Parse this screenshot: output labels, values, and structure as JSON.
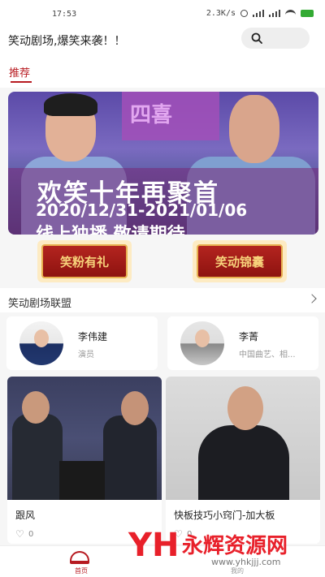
{
  "status": {
    "time": "17:53",
    "net_speed": "2.3K/s"
  },
  "topbar": {
    "slogan": "笑动剧场,爆笑来袭！！",
    "search_icon": "search-icon"
  },
  "tabs": [
    {
      "label": "推荐",
      "active": true
    }
  ],
  "banner": {
    "bg_text": "四喜",
    "title": "欢笑十年再聚首",
    "date_range": "2020/12/31-2021/01/06",
    "subtitle": "线上独播  敬请期待"
  },
  "buttons": {
    "fans_gift": "笑粉有礼",
    "smile_bag": "笑动锦囊"
  },
  "alliance": {
    "title": "笑动剧场联盟",
    "artists": [
      {
        "name": "李伟建",
        "role": "演员"
      },
      {
        "name": "李菁",
        "role": "中国曲艺、相..."
      }
    ]
  },
  "videos": [
    {
      "title": "跟风",
      "likes": "0"
    },
    {
      "title": "快板技巧小窍门-加大板",
      "likes": "0"
    }
  ],
  "bottom_nav": {
    "home": "首页",
    "mine": "我的"
  },
  "watermark": {
    "logo": "YH",
    "name": "永辉资源网",
    "url": "www.yhkjjj.com"
  },
  "colors": {
    "accent": "#b71a20",
    "button_gold": "#f7d27b",
    "watermark_red": "#e8202a"
  }
}
